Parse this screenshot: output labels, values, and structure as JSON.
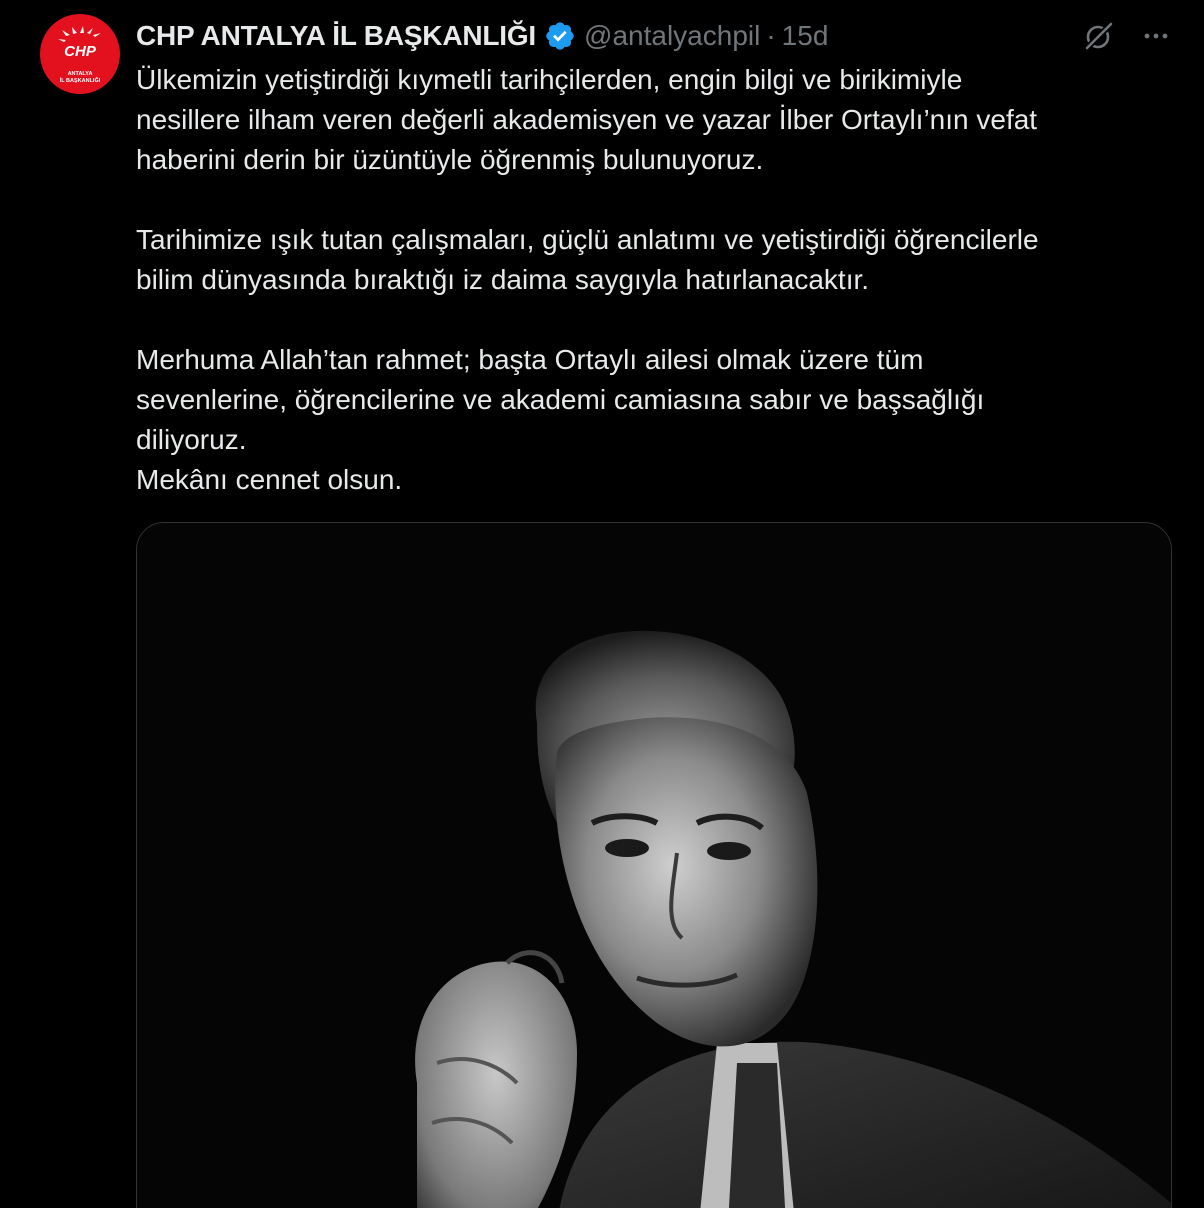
{
  "tweet": {
    "avatar": {
      "logo_text": "CHP",
      "sub_line_1": "ANTALYA",
      "sub_line_2": "İL BAŞKANLIĞI"
    },
    "display_name": "CHP ANTALYA İL BAŞKANLIĞI",
    "verified_icon": "verified-badge-icon",
    "handle": "@antalyachpil",
    "separator": "·",
    "time": "15d",
    "actions": {
      "grok_icon": "grok-icon",
      "more_icon": "more-options-icon"
    },
    "paragraphs": [
      "Ülkemizin yetiştirdiği kıymetli tarihçilerden, engin bilgi ve birikimiyle\nnesillere ilham veren değerli akademisyen ve yazar İlber Ortaylı’nın vefat\nhaberini derin bir üzüntüyle öğrenmiş bulunuyoruz.",
      "Tarihimize ışık tutan çalışmaları, güçlü anlatımı ve yetiştirdiği öğrencilerle\nbilim dünyasında bıraktığı iz daima saygıyla hatırlanacaktır.",
      "Merhuma Allah’tan rahmet; başta Ortaylı ailesi olmak üzere tüm\nsevenlerine, öğrencilerine ve akademi camiasına sabır ve başsağlığı\ndiliyoruz.\nMekânı cennet olsun."
    ],
    "media": {
      "kind": "black-and-white portrait photo"
    }
  },
  "colors": {
    "background": "#000000",
    "text": "#e7e9ea",
    "muted": "#71767b",
    "verified": "#1d9bf0",
    "avatar_red": "#e3101e",
    "border": "#2f3336"
  }
}
